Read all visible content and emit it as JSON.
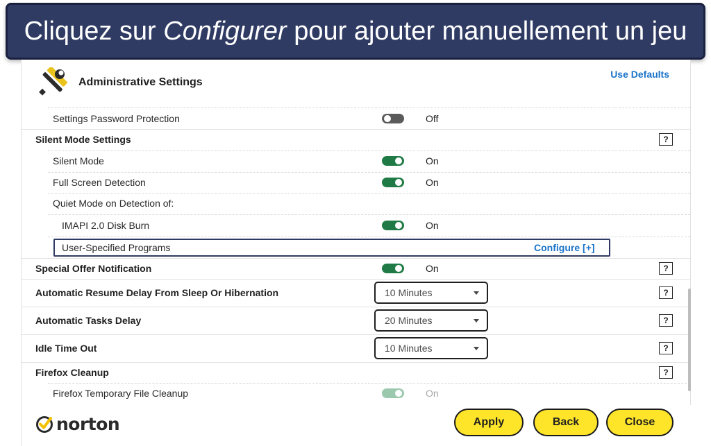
{
  "banner": {
    "prefix": "Cliquez sur ",
    "emphasis": "Configurer",
    "suffix": " pour ajouter manuellement un jeu"
  },
  "header": {
    "title": "Administrative Settings",
    "use_defaults": "Use Defaults",
    "icon": "tools-icon"
  },
  "rows": {
    "password_protection": {
      "label": "Settings Password Protection",
      "state": "Off"
    },
    "silent_mode_section": {
      "label": "Silent Mode Settings",
      "help": "?"
    },
    "silent_mode": {
      "label": "Silent Mode",
      "state": "On"
    },
    "full_screen": {
      "label": "Full Screen Detection",
      "state": "On"
    },
    "quiet_mode": {
      "label": "Quiet Mode on Detection of:"
    },
    "imapi": {
      "label": "IMAPI 2.0 Disk Burn",
      "state": "On"
    },
    "user_programs": {
      "label": "User-Specified Programs",
      "action": "Configure [+]"
    },
    "special_offer": {
      "label": "Special Offer Notification",
      "state": "On",
      "help": "?"
    },
    "resume_delay": {
      "label": "Automatic Resume Delay From Sleep Or Hibernation",
      "value": "10 Minutes",
      "help": "?"
    },
    "tasks_delay": {
      "label": "Automatic Tasks Delay",
      "value": "20 Minutes",
      "help": "?"
    },
    "idle_timeout": {
      "label": "Idle Time Out",
      "value": "10 Minutes",
      "help": "?"
    },
    "firefox_cleanup": {
      "label": "Firefox Cleanup",
      "help": "?"
    },
    "firefox_temp": {
      "label": "Firefox Temporary File Cleanup",
      "state": "On"
    }
  },
  "footer": {
    "brand": "norton",
    "apply": "Apply",
    "back": "Back",
    "close": "Close"
  },
  "colors": {
    "banner_bg": "#2f3b63",
    "toggle_on": "#1f7a45",
    "toggle_off": "#5b5b5b",
    "link": "#1a73c8",
    "button": "#ffe529"
  }
}
